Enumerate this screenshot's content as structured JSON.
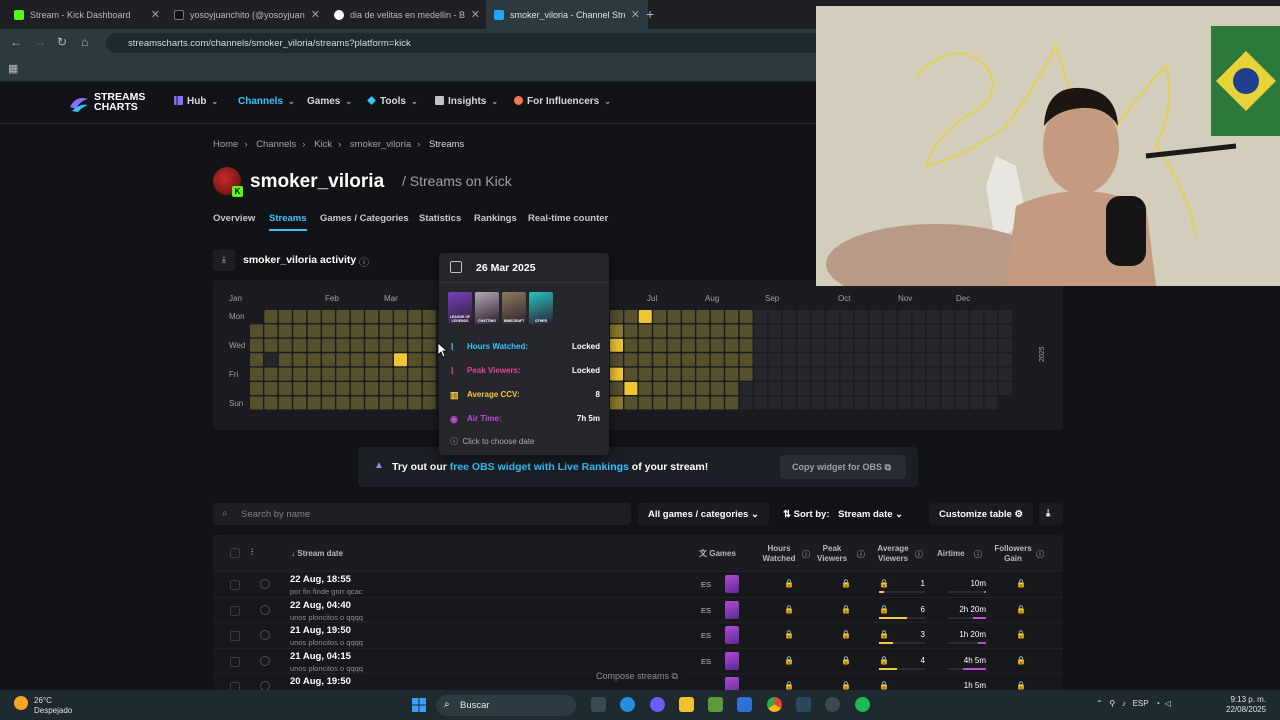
{
  "browser": {
    "tabs": [
      {
        "title": "Stream - Kick Dashboard",
        "favicon_color": "#53fc18",
        "active": false
      },
      {
        "title": "yosoyjuanchito (@yosoyjuanch",
        "favicon_color": "#111111",
        "active": false
      },
      {
        "title": "dia de velitas en medellin - Bus",
        "favicon_color": "#ffffff",
        "active": false
      },
      {
        "title": "smoker_viloria - Channel Strea",
        "favicon_color": "#1ea7ff",
        "active": true
      }
    ],
    "url": "streamscharts.com/channels/smoker_viloria/streams?platform=kick"
  },
  "site": {
    "logo_line1": "STREAMS",
    "logo_line2": "CHARTS",
    "nav": [
      {
        "label": "Hub",
        "icon": "bar-chart-icon",
        "active": false
      },
      {
        "label": "Channels",
        "icon": "",
        "active": true
      },
      {
        "label": "Games",
        "icon": "",
        "active": false
      },
      {
        "label": "Tools",
        "icon": "diamond-icon",
        "active": false
      },
      {
        "label": "Insights",
        "icon": "news-icon",
        "active": false
      },
      {
        "label": "For Influencers",
        "icon": "person-icon",
        "active": false
      }
    ]
  },
  "breadcrumbs": [
    "Home",
    "Channels",
    "Kick",
    "smoker_viloria",
    "Streams"
  ],
  "channel": {
    "name": "smoker_viloria",
    "subtitle": "/ Streams on Kick",
    "platform_badge": "K"
  },
  "subnav": [
    "Overview",
    "Streams",
    "Games / Categories",
    "Statistics",
    "Rankings",
    "Real-time counter"
  ],
  "activity": {
    "title": "smoker_viloria activity",
    "months": [
      "Jan",
      "Feb",
      "Mar",
      "Jul",
      "Aug",
      "Sep",
      "Oct",
      "Nov",
      "Dec"
    ],
    "weekdays": [
      "Mon",
      "Wed",
      "Fri",
      "Sun"
    ],
    "year": "2025",
    "colors": {
      "empty": "#26272c",
      "low": "#57502d",
      "mid": "#8c7a2a",
      "high": "#f0c533"
    }
  },
  "tooltip": {
    "date": "26 Mar 2025",
    "games": [
      {
        "label": "LEAGUE OF LEGENDS",
        "color": "#7b3fbf"
      },
      {
        "label": "CHATTING",
        "color": "#b9a6b3"
      },
      {
        "label": "MINECRAFT",
        "color": "#8e7b5a"
      },
      {
        "label": "OTHER",
        "color": "#2bc2c2"
      }
    ],
    "stats": [
      {
        "label": "Hours Watched:",
        "value": "Locked",
        "color": "#35c5ff"
      },
      {
        "label": "Peak Viewers:",
        "value": "Locked",
        "color": "#e2468c"
      },
      {
        "label": "Average CCV:",
        "value": "8",
        "color": "#f5c842"
      },
      {
        "label": "Air Time:",
        "value": "7h 5m",
        "color": "#c04bd6"
      }
    ],
    "footer": "Click to choose date"
  },
  "obs_banner": {
    "prefix": "Try out our ",
    "link": "free OBS widget with Live Rankings",
    "suffix": " of your stream!",
    "button": "Copy widget for OBS"
  },
  "toolbar": {
    "search_placeholder": "Search by name",
    "filter": "All games / categories",
    "sort_label": "Sort by:",
    "sort_value": "Stream date",
    "customize": "Customize table"
  },
  "table": {
    "headers": {
      "date": "Stream date",
      "games": "Games",
      "hours_watched": "Hours Watched",
      "peak_viewers": "Peak Viewers",
      "average_viewers": "Average Viewers",
      "airtime": "Airtime",
      "followers_gain": "Followers Gain"
    },
    "rows": [
      {
        "date": "22 Aug, 18:55",
        "title": "por fin finde gnrr qcac",
        "lang": "ES",
        "avg": "1",
        "avg_frac": 0.1,
        "airtime": "10m",
        "air_frac": 0.05
      },
      {
        "date": "22 Aug, 04:40",
        "title": "unos ploncitos o qqqq",
        "lang": "ES",
        "avg": "6",
        "avg_frac": 0.6,
        "airtime": "2h 20m",
        "air_frac": 0.35
      },
      {
        "date": "21 Aug, 19:50",
        "title": "unos ploncitos o qqqq",
        "lang": "ES",
        "avg": "3",
        "avg_frac": 0.3,
        "airtime": "1h 20m",
        "air_frac": 0.2
      },
      {
        "date": "21 Aug, 04:15",
        "title": "unos ploncitos o qqqq",
        "lang": "ES",
        "avg": "4",
        "avg_frac": 0.4,
        "airtime": "4h 5m",
        "air_frac": 0.6
      },
      {
        "date": "20 Aug, 19:50",
        "title": "",
        "lang": "",
        "avg": "",
        "avg_frac": 0,
        "airtime": "1h 5m",
        "air_frac": 0.15
      }
    ],
    "compose": "Compose streams"
  },
  "taskbar": {
    "temp": "26°C",
    "weather": "Despejado",
    "search": "Buscar",
    "lang": "ESP",
    "time": "9:13 p. m.",
    "date": "22/08/2025"
  }
}
